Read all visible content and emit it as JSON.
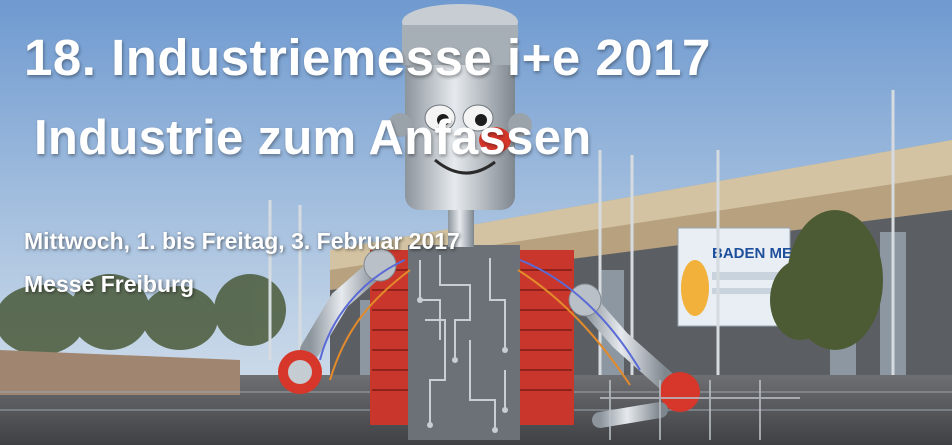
{
  "banner": {
    "headline": "18. Industriemesse i+e 2017",
    "subheadline": "Industrie zum Anfassen",
    "date": "Mittwoch, 1. bis Freitag, 3. Februar 2017",
    "location": "Messe Freiburg"
  },
  "scene": {
    "building_sign": "BADEN MESSE",
    "colors": {
      "sky_top": "#6f9ad0",
      "sky_bottom": "#cfdcea",
      "robot_red": "#c9372c",
      "robot_silver": "#b9c0c7",
      "circuit_board": "#6b7177"
    }
  }
}
